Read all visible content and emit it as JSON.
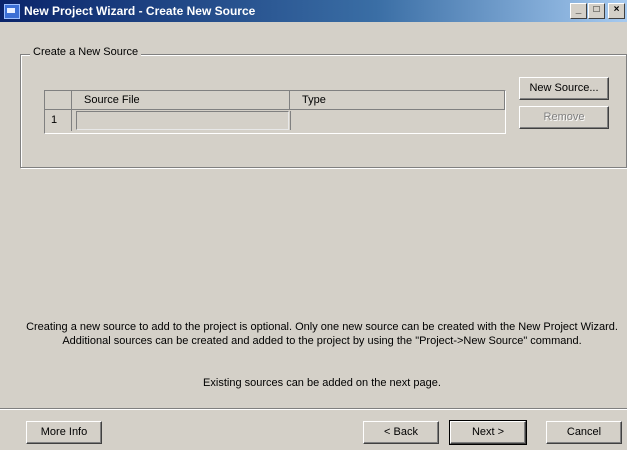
{
  "window": {
    "title": "New Project Wizard - Create New Source",
    "minimize": "_",
    "maximize": "□",
    "close": "×"
  },
  "group": {
    "legend": "Create a New Source"
  },
  "table": {
    "columns": [
      "Source File",
      "Type"
    ],
    "rows": [
      {
        "num": "1",
        "source_file": "",
        "type": ""
      }
    ]
  },
  "buttons": {
    "new_source": "New Source...",
    "remove": "Remove",
    "more_info": "More Info",
    "back": "< Back",
    "next": "Next >",
    "cancel": "Cancel"
  },
  "message": {
    "line1": "Creating a new source to add to the project is optional. Only one new source can be created with the New Project Wizard. Additional sources can be created and added to the project by using the \"Project->New Source\" command.",
    "line2": "Existing sources can be added on the next page."
  }
}
